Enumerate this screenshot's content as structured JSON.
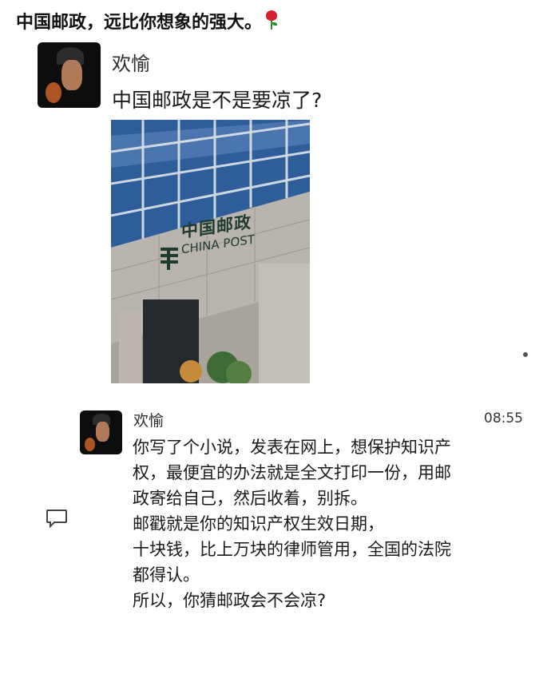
{
  "post_title": "中国邮政，远比你想象的强大。",
  "title_emoji": "rose-icon",
  "first_message": {
    "author": "欢愉",
    "text": "中国邮政是不是要凉了?",
    "photo": {
      "sign_chinese": "中国邮政",
      "sign_english": "CHINA POST"
    }
  },
  "second_message": {
    "author": "欢愉",
    "time": "08:55",
    "lines": [
      "你写了个小说，发表在网上，想保护知识产",
      "权，最便宜的办法就是全文打印一份，用邮",
      "政寄给自己，然后收着，别拆。",
      "邮戳就是你的知识产权生效日期，",
      "十块钱，比上万块的律师管用，全国的法院",
      "都得认。",
      "所以，你猜邮政会不会凉?"
    ]
  },
  "colors": {
    "post_green": "#1d3b2e",
    "rose_red": "#d61f2a"
  }
}
